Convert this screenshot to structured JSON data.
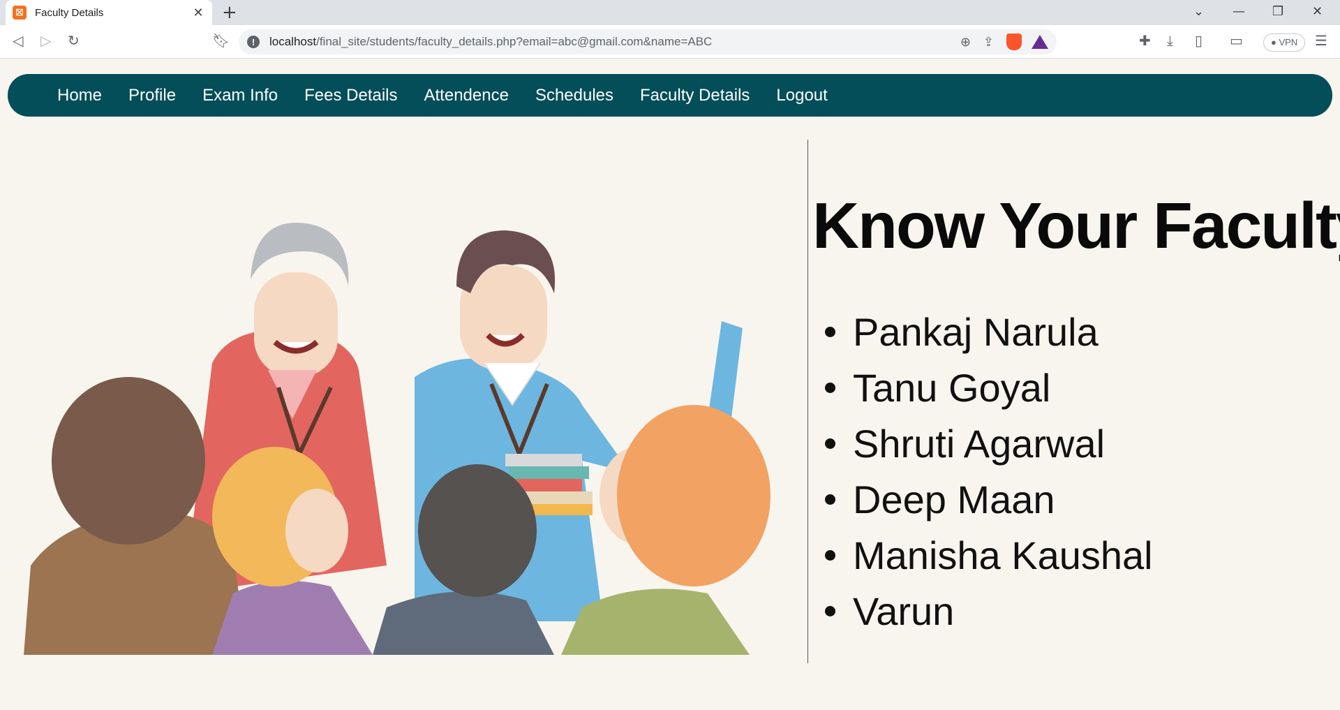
{
  "browser": {
    "tab_title": "Faculty Details",
    "favicon_text": "⛝",
    "url_host": "localhost",
    "url_path": "/final_site/students/faculty_details.php?email=abc@gmail.com&name=ABC",
    "vpn_label": "VPN"
  },
  "nav": {
    "items": [
      {
        "label": "Home"
      },
      {
        "label": "Profile"
      },
      {
        "label": "Exam Info"
      },
      {
        "label": "Fees Details"
      },
      {
        "label": "Attendence"
      },
      {
        "label": "Schedules"
      },
      {
        "label": "Faculty Details"
      },
      {
        "label": "Logout"
      }
    ]
  },
  "main": {
    "heading": "Know Your Faculty",
    "faculty": [
      {
        "name": "Pankaj Narula"
      },
      {
        "name": "Tanu Goyal"
      },
      {
        "name": "Shruti Agarwal"
      },
      {
        "name": "Deep Maan"
      },
      {
        "name": "Manisha Kaushal"
      },
      {
        "name": "Varun"
      }
    ]
  },
  "colors": {
    "nav_bg": "#034e58",
    "page_bg": "#f8f5ee"
  }
}
